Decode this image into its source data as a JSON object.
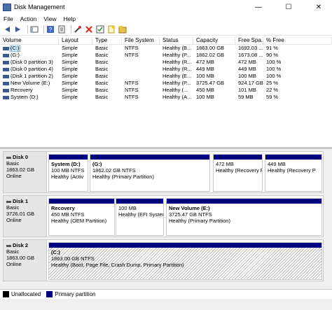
{
  "window": {
    "title": "Disk Management",
    "minimize": "—",
    "maximize": "☐",
    "close": "✕"
  },
  "menu": [
    "File",
    "Action",
    "View",
    "Help"
  ],
  "toolbar": [
    "back-icon",
    "forward-icon",
    "console-icon",
    "help-icon",
    "properties-icon",
    "connect-icon",
    "delete-icon",
    "check-icon",
    "new-icon",
    "export-icon"
  ],
  "columns": [
    "Volume",
    "Layout",
    "Type",
    "File System",
    "Status",
    "Capacity",
    "Free Spa...",
    "% Free"
  ],
  "volumes": [
    {
      "volume": "(C:)",
      "layout": "Simple",
      "type": "Basic",
      "fs": "NTFS",
      "status": "Healthy (B...",
      "capacity": "1863.00 GB",
      "free": "1692.03 ...",
      "pct": "91 %"
    },
    {
      "volume": "(G:)",
      "layout": "Simple",
      "type": "Basic",
      "fs": "NTFS",
      "status": "Healthy (P...",
      "capacity": "1862.02 GB",
      "free": "1673.08 ...",
      "pct": "90 %"
    },
    {
      "volume": "(Disk 0 partition 3)",
      "layout": "Simple",
      "type": "Basic",
      "fs": "",
      "status": "Healthy (R...",
      "capacity": "472 MB",
      "free": "472 MB",
      "pct": "100 %"
    },
    {
      "volume": "(Disk 0 partition 4)",
      "layout": "Simple",
      "type": "Basic",
      "fs": "",
      "status": "Healthy (R...",
      "capacity": "449 MB",
      "free": "449 MB",
      "pct": "100 %"
    },
    {
      "volume": "(Disk 1 partition 2)",
      "layout": "Simple",
      "type": "Basic",
      "fs": "",
      "status": "Healthy (E...",
      "capacity": "100 MB",
      "free": "100 MB",
      "pct": "100 %"
    },
    {
      "volume": "New Volume (E:)",
      "layout": "Simple",
      "type": "Basic",
      "fs": "NTFS",
      "status": "Healthy (P...",
      "capacity": "3725.47 GB",
      "free": "924.17 GB",
      "pct": "25 %"
    },
    {
      "volume": "Recovery",
      "layout": "Simple",
      "type": "Basic",
      "fs": "NTFS",
      "status": "Healthy (...",
      "capacity": "450 MB",
      "free": "101 MB",
      "pct": "22 %"
    },
    {
      "volume": "System (D:)",
      "layout": "Simple",
      "type": "Basic",
      "fs": "NTFS",
      "status": "Healthy (A...",
      "capacity": "100 MB",
      "free": "59 MB",
      "pct": "59 %"
    }
  ],
  "disks": [
    {
      "name": "Disk 0",
      "type": "Basic",
      "size": "1863.02 GB",
      "state": "Online",
      "partitions": [
        {
          "name": "System  (D:)",
          "size": "100 MB NTFS",
          "status": "Healthy (Activ"
        },
        {
          "name": "(G:)",
          "size": "1862.02 GB NTFS",
          "status": "Healthy (Primary Partition)"
        },
        {
          "name": "",
          "size": "472 MB",
          "status": "Healthy (Recovery P"
        },
        {
          "name": "",
          "size": "449 MB",
          "status": "Healthy (Recovery P"
        }
      ]
    },
    {
      "name": "Disk 1",
      "type": "Basic",
      "size": "3726.01 GB",
      "state": "Online",
      "partitions": [
        {
          "name": "Recovery",
          "size": "450 MB NTFS",
          "status": "Healthy (OEM Partition)"
        },
        {
          "name": "",
          "size": "100 MB",
          "status": "Healthy (EFI Syster"
        },
        {
          "name": "New Volume  (E:)",
          "size": "3725.47 GB NTFS",
          "status": "Healthy (Primary Partition)"
        }
      ]
    },
    {
      "name": "Disk 2",
      "type": "Basic",
      "size": "1863.00 GB",
      "state": "Online",
      "partitions": [
        {
          "name": "(C:)",
          "size": "1863.00 GB NTFS",
          "status": "Healthy (Boot, Page File, Crash Dump, Primary Partition)"
        }
      ]
    }
  ],
  "legend": [
    {
      "label": "Unallocated",
      "color": "#000000"
    },
    {
      "label": "Primary partition",
      "color": "#00007f"
    }
  ]
}
